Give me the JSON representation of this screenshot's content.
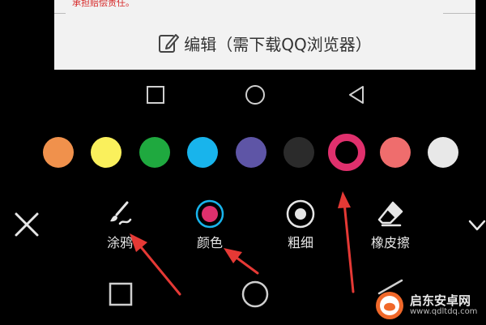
{
  "doc": {
    "warning": "承担赔偿责任。",
    "edit_label": "编辑（需下载QQ浏览器）"
  },
  "palette": {
    "colors": [
      "#f0914c",
      "#faf05c",
      "#1fa93f",
      "#18b4ec",
      "#5e55a6",
      "#2b2b2b",
      "#e0306d",
      "#ef6d6d",
      "#e8e8e8"
    ],
    "selected_index": 6
  },
  "tools": {
    "close": "close-icon",
    "doodle_label": "涂鸦",
    "color_label": "颜色",
    "thickness_label": "粗细",
    "eraser_label": "橡皮擦",
    "collapse": "chevron-down-icon"
  },
  "watermark": {
    "main": "启东安卓网",
    "url": "www.qdltdq.com"
  },
  "colors": {
    "accent": "#e0306d",
    "arrow": "#e53935"
  }
}
